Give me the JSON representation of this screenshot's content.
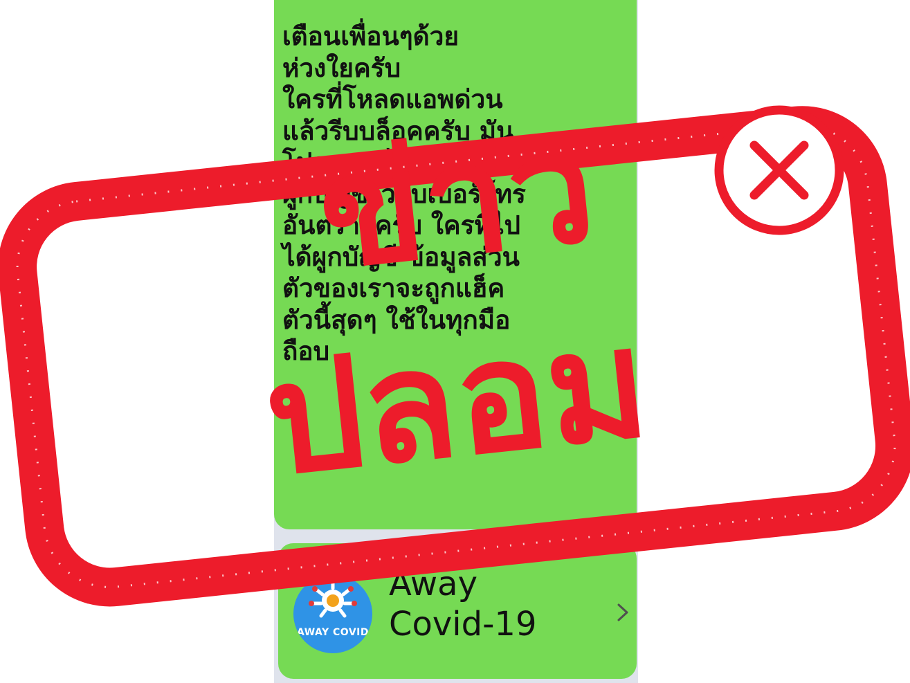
{
  "message": {
    "text": "เตือนเพื่อนๆด้วย\nห่วงใยครับ\n ใครที่โหลดแอพด่วน\nแล้วรีบบล็อคครับ มัน\nโปรแกรมไวรัส ใครที่\nผูกบัญชีไว้กับเบอร์โทร\nอันตรายครับ ใครที่ไป\nได้ผูกบัญชี ข้อมูลส่วน\nตัวของเราจะถูกแฮ็ค\nตัวนี้สุดๆ ใช้ในทุกมือ\nถือบ"
  },
  "link_card": {
    "title": "Away\nCovid-19",
    "logo_text": "AWAY COVID"
  },
  "stamp": {
    "line1": "ข่าว",
    "line2": "ปลอม",
    "color": "#ed1c2b"
  },
  "colors": {
    "bubble": "#76da54",
    "background": "#dfe3ec",
    "logo_bg": "#2f93e6"
  },
  "icons": {
    "close": "close-circle-icon",
    "chevron": "chevron-right-icon"
  }
}
